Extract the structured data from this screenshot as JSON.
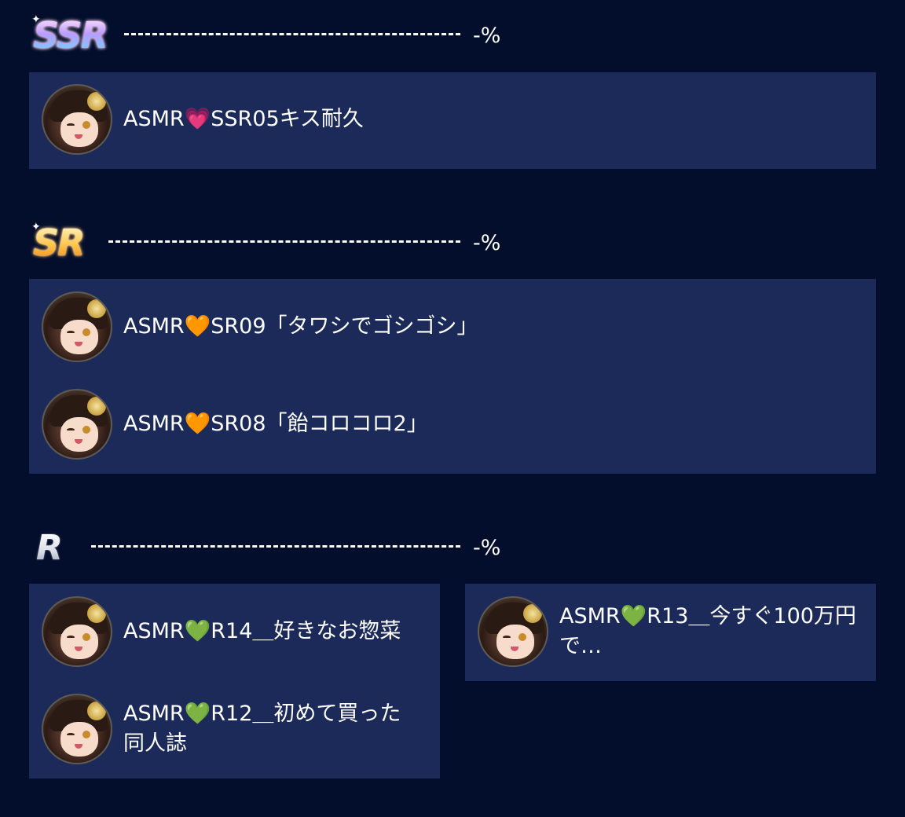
{
  "sections": [
    {
      "rarity": "SSR",
      "percent": "-%",
      "items": [
        {
          "title": "ASMR💗SSR05キス耐久",
          "avatar_icon": "character-avatar-icon"
        }
      ]
    },
    {
      "rarity": "SR",
      "percent": "-%",
      "items": [
        {
          "title": "ASMR🧡SR09「タワシでゴシゴシ」",
          "avatar_icon": "character-avatar-icon"
        },
        {
          "title": "ASMR🧡SR08「飴コロコロ2」",
          "avatar_icon": "character-avatar-icon"
        }
      ]
    },
    {
      "rarity": "R",
      "percent": "-%",
      "items": [
        {
          "title": "ASMR💚R14＿好きなお惣菜",
          "avatar_icon": "character-avatar-icon"
        },
        {
          "title": "ASMR💚R12＿初めて買った同人誌",
          "avatar_icon": "character-avatar-icon"
        },
        {
          "title": "ASMR💚R13＿今すぐ100万円で…",
          "avatar_icon": "character-avatar-icon"
        }
      ]
    }
  ],
  "colors": {
    "background": "#030e2c",
    "panel": "#1c2a5a",
    "text": "#ffffff"
  }
}
